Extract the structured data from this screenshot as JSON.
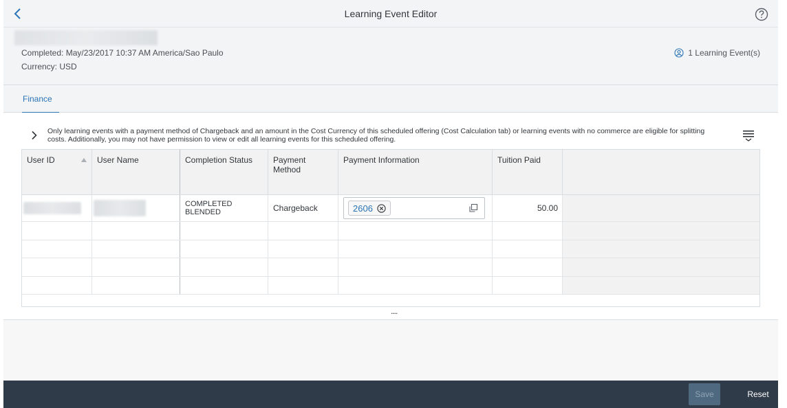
{
  "header": {
    "title": "Learning Event Editor",
    "completed": "Completed: May/23/2017 10:37 AM America/Sao Paulo",
    "currency": "Currency: USD",
    "events_link": "1 Learning Event(s)"
  },
  "tabs": [
    {
      "label": "Finance",
      "selected": true
    }
  ],
  "info_text": "Only learning events with a payment method of Chargeback and an amount in the Cost Currency of this scheduled offering (Cost Calculation tab) or learning events with no commerce are eligible for splitting costs. Additionally, you may not have permission to view or edit all learning events for this scheduled offering.",
  "table": {
    "columns": [
      "User ID",
      "User Name",
      "Completion Status",
      "Payment Method",
      "Payment Information",
      "Tuition Paid"
    ],
    "rows": [
      {
        "completion_status": "COMPLETED BLENDED",
        "payment_method": "Chargeback",
        "payment_token": "2606",
        "tuition_paid": "50.00"
      }
    ],
    "grip": "...."
  },
  "footer": {
    "save_label": "Save",
    "reset_label": "Reset"
  },
  "colors": {
    "accent": "#2a73b5",
    "footer_bg": "#2f3b49",
    "save_bg": "#4f6a80"
  },
  "icons": {
    "back": "chevron-left-icon",
    "help": "question-circle-icon",
    "events": "person-circle-icon",
    "expand": "chevron-right-icon",
    "settings": "table-settings-icon",
    "sort": "sort-ascending-icon",
    "token_remove": "close-circle-icon",
    "value_help": "value-help-icon"
  }
}
